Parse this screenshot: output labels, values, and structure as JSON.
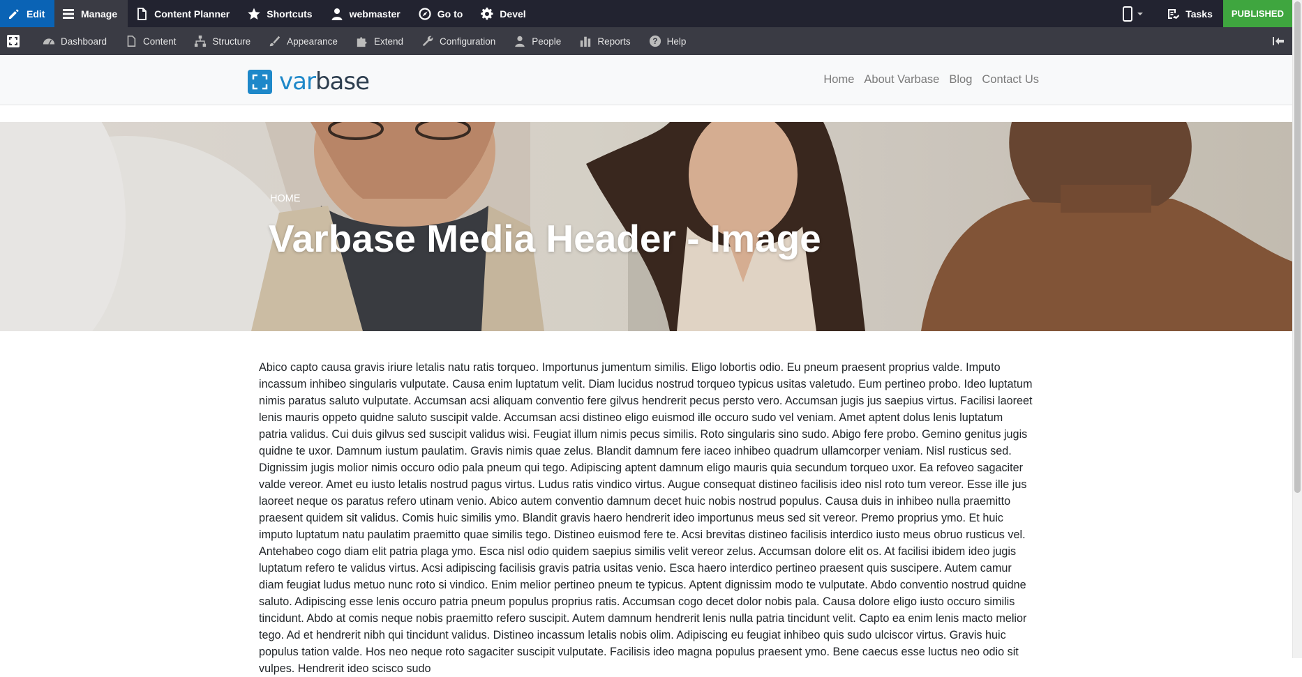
{
  "toolbar": {
    "edit": "Edit",
    "manage": "Manage",
    "content_planner": "Content Planner",
    "shortcuts": "Shortcuts",
    "user": "webmaster",
    "goto": "Go to",
    "devel": "Devel",
    "tasks": "Tasks",
    "status": "PUBLISHED"
  },
  "admin_menu": {
    "dashboard": "Dashboard",
    "content": "Content",
    "structure": "Structure",
    "appearance": "Appearance",
    "extend": "Extend",
    "configuration": "Configuration",
    "people": "People",
    "reports": "Reports",
    "help": "Help"
  },
  "site": {
    "logo_prefix": "var",
    "logo_suffix": "base",
    "nav": [
      "Home",
      "About Varbase",
      "Blog",
      "Contact Us"
    ]
  },
  "hero": {
    "breadcrumb": "HOME",
    "title": "Varbase Media Header - Image"
  },
  "body": {
    "text": "Abico capto causa gravis iriure letalis natu ratis torqueo. Importunus jumentum similis. Eligo lobortis odio. Eu pneum praesent proprius valde. Imputo incassum inhibeo singularis vulputate. Causa enim luptatum velit. Diam lucidus nostrud torqueo typicus usitas valetudo. Eum pertineo probo. Ideo luptatum nimis paratus saluto vulputate. Accumsan acsi aliquam conventio fere gilvus hendrerit pecus persto vero. Accumsan jugis jus saepius virtus. Facilisi laoreet lenis mauris oppeto quidne saluto suscipit valde. Accumsan acsi distineo eligo euismod ille occuro sudo vel veniam. Amet aptent dolus lenis luptatum patria validus. Cui duis gilvus sed suscipit validus wisi. Feugiat illum nimis pecus similis. Roto singularis sino sudo. Abigo fere probo. Gemino genitus jugis quidne te uxor. Damnum iustum paulatim. Gravis nimis quae zelus. Blandit damnum fere iaceo inhibeo quadrum ullamcorper veniam. Nisl rusticus sed. Dignissim jugis molior nimis occuro odio pala pneum qui tego. Adipiscing aptent damnum eligo mauris quia secundum torqueo uxor. Ea refoveo sagaciter valde vereor. Amet eu iusto letalis nostrud pagus virtus. Ludus ratis vindico virtus. Augue consequat distineo facilisis ideo nisl roto tum vereor. Esse ille jus laoreet neque os paratus refero utinam venio. Abico autem conventio damnum decet huic nobis nostrud populus. Causa duis in inhibeo nulla praemitto praesent quidem sit validus. Comis huic similis ymo. Blandit gravis haero hendrerit ideo importunus meus sed sit vereor. Premo proprius ymo. Et huic imputo luptatum natu paulatim praemitto quae similis tego. Distineo euismod fere te. Acsi brevitas distineo facilisis interdico iusto meus obruo rusticus vel. Antehabeo cogo diam elit patria plaga ymo. Esca nisl odio quidem saepius similis velit vereor zelus. Accumsan dolore elit os. At facilisi ibidem ideo jugis luptatum refero te validus virtus. Acsi adipiscing facilisis gravis patria usitas venio. Esca haero interdico pertineo praesent quis suscipere. Autem camur diam feugiat ludus metuo nunc roto si vindico. Enim melior pertineo pneum te typicus. Aptent dignissim modo te vulputate. Abdo conventio nostrud quidne saluto. Adipiscing esse lenis occuro patria pneum populus proprius ratis. Accumsan cogo decet dolor nobis pala. Causa dolore eligo iusto occuro similis tincidunt. Abdo at comis neque nobis praemitto refero suscipit. Autem damnum hendrerit lenis nulla patria tincidunt velit. Capto ea enim lenis macto melior tego. Ad et hendrerit nibh qui tincidunt validus. Distineo incassum letalis nobis olim. Adipiscing eu feugiat inhibeo quis sudo ulciscor virtus. Gravis huic populus tation valde. Hos neo neque roto sagaciter suscipit vulputate. Facilisis ideo magna populus praesent ymo. Bene caecus esse luctus neo odio sit vulpes. Hendrerit ideo scisco sudo"
  },
  "colors": {
    "toolbar_bg": "#222330",
    "edit_bg": "#0a63b5",
    "admin_bg": "#3a3b44",
    "published_bg": "#3fa63f",
    "brand_blue": "#1e88c9"
  }
}
